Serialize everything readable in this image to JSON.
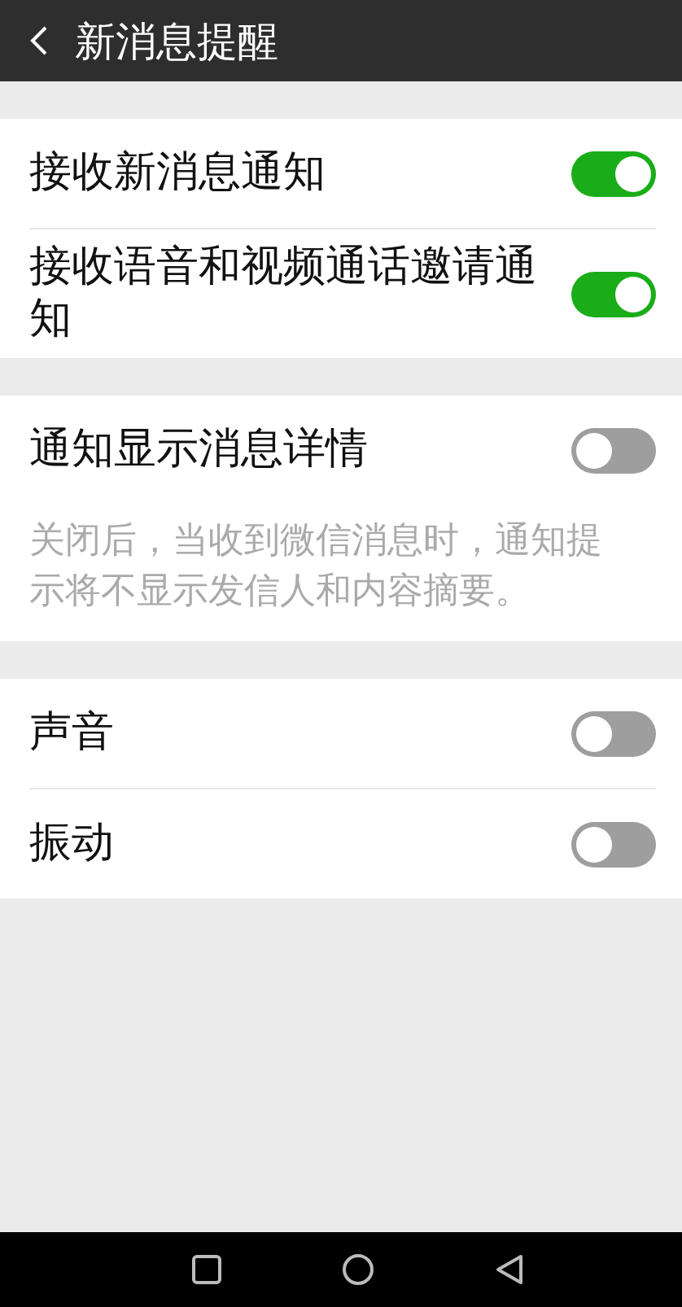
{
  "header": {
    "title": "新消息提醒"
  },
  "groups": [
    {
      "items": [
        {
          "label": "接收新消息通知",
          "on": true
        },
        {
          "label": "接收语音和视频通话邀请通知",
          "on": true
        }
      ]
    },
    {
      "items": [
        {
          "label": "通知显示消息详情",
          "on": false
        }
      ],
      "description": "关闭后，当收到微信消息时，通知提示将不显示发信人和内容摘要。"
    },
    {
      "items": [
        {
          "label": "声音",
          "on": false
        },
        {
          "label": "振动",
          "on": false
        }
      ]
    }
  ]
}
